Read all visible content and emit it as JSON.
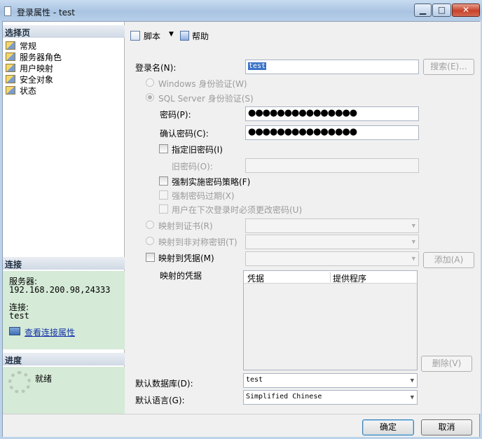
{
  "window": {
    "title": "登录属性 - test",
    "minimize_label": "▁",
    "maximize_label": "□",
    "close_label": "✕"
  },
  "left_panel": {
    "pages_header": "选择页",
    "pages": [
      {
        "label": "常规"
      },
      {
        "label": "服务器角色"
      },
      {
        "label": "用户映射"
      },
      {
        "label": "安全对象"
      },
      {
        "label": "状态"
      }
    ],
    "connection_header": "连接",
    "server_label": "服务器:",
    "server_value": "192.168.200.98,24333",
    "connection_label": "连接:",
    "connection_value": "test",
    "view_connection_link": "查看连接属性",
    "progress_header": "进度",
    "progress_status": "就绪"
  },
  "toolbar": {
    "script_label": "脚本",
    "help_label": "帮助"
  },
  "form": {
    "login_name_label": "登录名(N):",
    "login_name_value": "test",
    "search_button": "搜索(E)...",
    "windows_auth_label": "Windows 身份验证(W)",
    "sql_auth_label": "SQL Server 身份验证(S)",
    "password_label": "密码(P):",
    "password_value": "●●●●●●●●●●●●●●●",
    "confirm_password_label": "确认密码(C):",
    "confirm_password_value": "●●●●●●●●●●●●●●●",
    "specify_old_password_label": "指定旧密码(I)",
    "old_password_label": "旧密码(O):",
    "old_password_value": "",
    "enforce_policy_label": "强制实施密码策略(F)",
    "enforce_expiration_label": "强制密码过期(X)",
    "must_change_label": "用户在下次登录时必须更改密码(U)",
    "map_certificate_label": "映射到证书(R)",
    "map_asymmetric_key_label": "映射到非对称密钥(T)",
    "map_credential_label": "映射到凭据(M)",
    "add_button": "添加(A)",
    "mapped_credentials_label": "映射的凭据",
    "credentials_columns": [
      "凭据",
      "提供程序"
    ],
    "remove_button": "删除(V)",
    "default_database_label": "默认数据库(D):",
    "default_database_value": "test",
    "default_language_label": "默认语言(G):",
    "default_language_value": "Simplified Chinese"
  },
  "footer": {
    "ok_button": "确定",
    "cancel_button": "取消"
  }
}
